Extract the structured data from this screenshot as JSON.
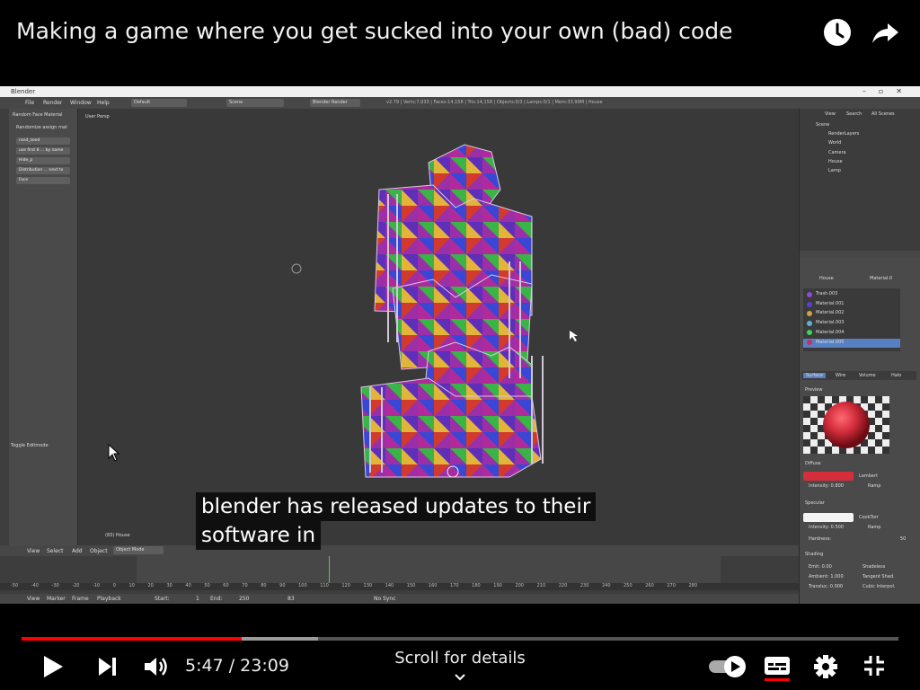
{
  "player": {
    "title": "Making a game where you get sucked into your own (bad) code",
    "watch_later_icon": "clock-icon",
    "share_icon": "share-arrow-icon",
    "subtitles": [
      "blender has released updates to their",
      "software in"
    ],
    "progress": {
      "played_fraction": 0.251,
      "buffered_fraction": 0.338
    },
    "current_time": "5:47",
    "duration": "23:09",
    "time_separator": " / ",
    "scroll_hint": "Scroll for details",
    "colors": {
      "played": "#ff0000",
      "background": "#000000",
      "caption_underline": "#ff0000"
    }
  },
  "blender": {
    "window_title": "Blender",
    "menu": [
      "File",
      "Render",
      "Window",
      "Help"
    ],
    "layout": "Default",
    "scene": "Scene",
    "engine": "Blender Render",
    "info": "v2.79 | Verts:7,933 | Faces:14,158 | Tris:14,158 | Objects:0/3 | Lamps:0/1 | Mem:33.99M | House",
    "toolshelf": {
      "panel_title": "Random Face Material",
      "fields": [
        "Randomize assign mat",
        "rand_seed",
        "use first 8 ... by name",
        "Hide_p",
        "Distribution ... next to",
        "Face"
      ],
      "bottom_label": "Toggle Editmode"
    },
    "viewport": {
      "view_label": "User Persp",
      "object_label": "(83) House"
    },
    "header3d": [
      "View",
      "Select",
      "Add",
      "Object",
      "Object Mode"
    ],
    "timeline": {
      "ruler": [
        "-50",
        "-40",
        "-30",
        "-20",
        "-10",
        "0",
        "10",
        "20",
        "30",
        "40",
        "50",
        "60",
        "70",
        "80",
        "90",
        "100",
        "110",
        "120",
        "130",
        "140",
        "150",
        "160",
        "170",
        "180",
        "190",
        "200",
        "210",
        "220",
        "230",
        "240",
        "250",
        "260",
        "270",
        "280"
      ],
      "footer": [
        "View",
        "Marker",
        "Frame",
        "Playback",
        "Start:",
        "1",
        "End:",
        "250",
        "83",
        "No Sync"
      ]
    },
    "outliner": {
      "tabs": [
        "View",
        "Search",
        "All Scenes"
      ],
      "items": [
        "Scene",
        "RenderLayers",
        "World",
        "Camera",
        "House",
        "Lamp"
      ]
    },
    "properties": {
      "object": "House",
      "material_slot": "Material.0",
      "materials": [
        "Trash.003",
        "Material.001",
        "Material.002",
        "Material.003",
        "Material.004",
        "Material.005"
      ],
      "material_colors": [
        "#8a4bd6",
        "#5a3fd0",
        "#d6a23a",
        "#5fb0d8",
        "#3ad55a",
        "#c43060"
      ],
      "active_material": "Material.005",
      "tabs": [
        "Surface",
        "Wire",
        "Volume",
        "Halo"
      ],
      "sections": [
        "Preview",
        "Diffuse",
        "Specular",
        "Shading"
      ],
      "diffuse": {
        "shader": "Lambert",
        "intensity": "Intensity: 0.800",
        "ramp": "Ramp",
        "color": "#d42e3c"
      },
      "specular": {
        "shader": "CookTorr",
        "intensity": "Intensity: 0.500",
        "ramp": "Ramp",
        "hardness": "Hardness:",
        "hardness_value": "50",
        "color": "#f4f4f4"
      },
      "shading": {
        "emit": "Emit: 0.00",
        "shadeless": "Shadeless",
        "ambient": "Ambient: 1.000",
        "tangent": "Tangent Shad.",
        "translucency": "Transluc: 0.000",
        "cubic": "Cubic Interpol."
      }
    }
  }
}
